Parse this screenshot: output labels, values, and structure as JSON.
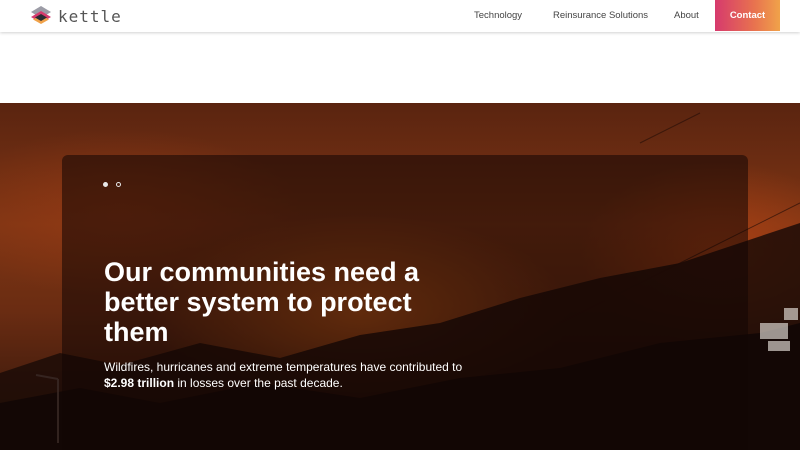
{
  "nav": {
    "logo_text": "kettle",
    "links": [
      "Technology",
      "Reinsurance Solutions",
      "About"
    ],
    "contact_label": "Contact"
  },
  "hero": {
    "carousel": {
      "slide_count": 2,
      "active_index": 0
    },
    "title": "Our communities need a better system to protect them",
    "body_prefix": "Wildfires, hurricanes and extreme temperatures have contributed to",
    "body_highlight": "$2.98 trillion",
    "body_suffix": " in losses over the past decade."
  },
  "colors": {
    "contact_gradient_start": "#d63a6d",
    "contact_gradient_end": "#f0a24a",
    "hero_text": "#ffffff"
  }
}
